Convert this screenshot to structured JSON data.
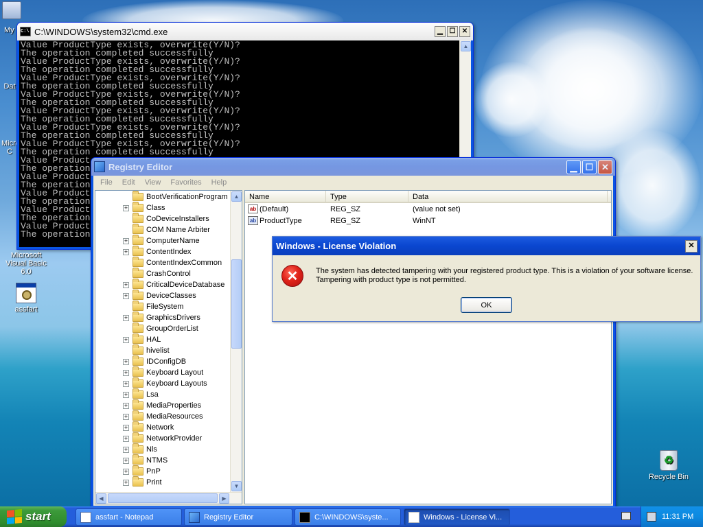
{
  "desktop": {
    "icons": [
      {
        "label": "My"
      },
      {
        "label": "Dat"
      },
      {
        "label": "Micro"
      },
      {
        "label": "C"
      },
      {
        "label": "Microsoft Visual Basic 6.0"
      },
      {
        "label": "assfart"
      },
      {
        "label": "Recycle Bin"
      }
    ]
  },
  "cmd": {
    "title": "C:\\WINDOWS\\system32\\cmd.exe",
    "lines": [
      "Value ProductType exists, overwrite(Y/N)?",
      "The operation completed successfully",
      "Value ProductType exists, overwrite(Y/N)?",
      "The operation completed successfully",
      "Value ProductType exists, overwrite(Y/N)?",
      "The operation completed successfully",
      "Value ProductType exists, overwrite(Y/N)?",
      "The operation completed successfully",
      "Value ProductType exists, overwrite(Y/N)?",
      "The operation completed successfully",
      "Value ProductType exists, overwrite(Y/N)?",
      "The operation completed successfully",
      "Value ProductType exists, overwrite(Y/N)?",
      "The operation completed successfully",
      "Value Product",
      "The operation",
      "Value Product",
      "The operation",
      "Value Product",
      "The operation",
      "Value Product",
      "The operation",
      "Value Product",
      "The operation"
    ]
  },
  "regedit": {
    "title": "Registry Editor",
    "menu": [
      "File",
      "Edit",
      "View",
      "Favorites",
      "Help"
    ],
    "tree": [
      {
        "label": "BootVerificationProgram",
        "expandable": false
      },
      {
        "label": "Class",
        "expandable": true
      },
      {
        "label": "CoDeviceInstallers",
        "expandable": false
      },
      {
        "label": "COM Name Arbiter",
        "expandable": false
      },
      {
        "label": "ComputerName",
        "expandable": true
      },
      {
        "label": "ContentIndex",
        "expandable": true
      },
      {
        "label": "ContentIndexCommon",
        "expandable": false
      },
      {
        "label": "CrashControl",
        "expandable": false
      },
      {
        "label": "CriticalDeviceDatabase",
        "expandable": true
      },
      {
        "label": "DeviceClasses",
        "expandable": true
      },
      {
        "label": "FileSystem",
        "expandable": false
      },
      {
        "label": "GraphicsDrivers",
        "expandable": true
      },
      {
        "label": "GroupOrderList",
        "expandable": false
      },
      {
        "label": "HAL",
        "expandable": true
      },
      {
        "label": "hivelist",
        "expandable": false
      },
      {
        "label": "IDConfigDB",
        "expandable": true
      },
      {
        "label": "Keyboard Layout",
        "expandable": true
      },
      {
        "label": "Keyboard Layouts",
        "expandable": true
      },
      {
        "label": "Lsa",
        "expandable": true
      },
      {
        "label": "MediaProperties",
        "expandable": true
      },
      {
        "label": "MediaResources",
        "expandable": true
      },
      {
        "label": "Network",
        "expandable": true
      },
      {
        "label": "NetworkProvider",
        "expandable": true
      },
      {
        "label": "Nls",
        "expandable": true
      },
      {
        "label": "NTMS",
        "expandable": true
      },
      {
        "label": "PnP",
        "expandable": true
      },
      {
        "label": "Print",
        "expandable": true
      }
    ],
    "columns": [
      "Name",
      "Type",
      "Data"
    ],
    "values": [
      {
        "name": "(Default)",
        "type": "REG_SZ",
        "data": "(value not set)",
        "icon": "string-value-icon"
      },
      {
        "name": "ProductType",
        "type": "REG_SZ",
        "data": "WinNT",
        "icon": "string-value-icon"
      }
    ]
  },
  "dialog": {
    "title": "Windows - License Violation",
    "message_line1": "The system has detected tampering with your registered product type. This is a violation of your software license.",
    "message_line2": "Tampering with product type is not permitted.",
    "ok_label": "OK",
    "close_glyph": "✕"
  },
  "taskbar": {
    "start_label": "start",
    "tasks": [
      {
        "label": "assfart - Notepad",
        "active": false
      },
      {
        "label": "Registry Editor",
        "active": false
      },
      {
        "label": "C:\\WINDOWS\\syste...",
        "active": false
      },
      {
        "label": "Windows - License Vi...",
        "active": true
      }
    ],
    "clock": "11:31 PM"
  },
  "colors": {
    "xp_blue": "#0554e0",
    "start_green": "#3c9a3a",
    "error_red": "#e0241a"
  }
}
